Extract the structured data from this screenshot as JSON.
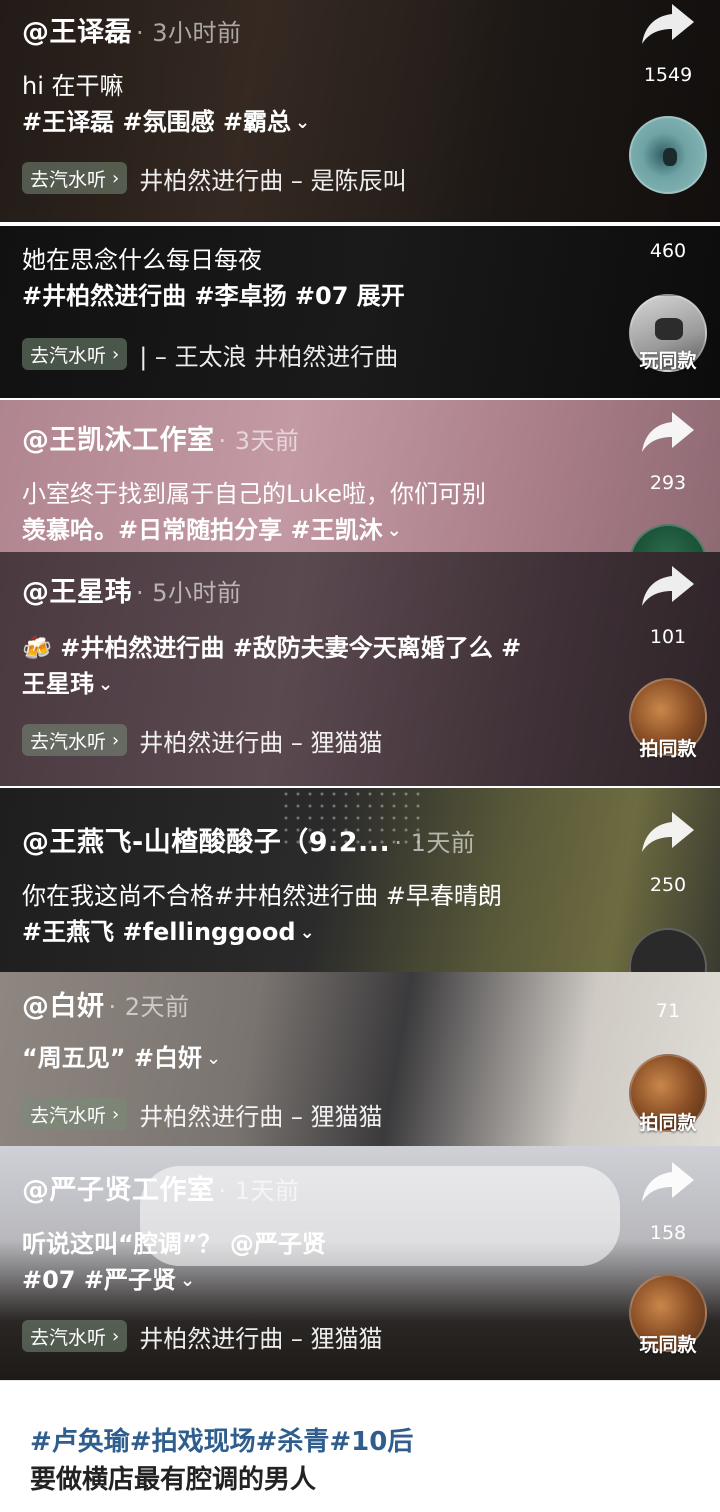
{
  "cards": [
    {
      "author": "@王译磊",
      "time": "· 3小时前",
      "desc_text": "hi 在干嘛",
      "desc_tags": "#王译磊 #氛围感 #霸总",
      "music_btn": "去汽水听",
      "music_text": "井柏然进行曲 – 是陈辰叫",
      "share_count": "1549",
      "disc_label": ""
    },
    {
      "author": "",
      "time": "",
      "desc_text": "她在思念什么每日每夜",
      "desc_tags": "#井柏然进行曲 #李卓扬 #07  展开",
      "music_btn": "去汽水听",
      "music_text": "| – 王太浪  井柏然进行曲",
      "share_count": "460",
      "disc_label": "玩同款"
    },
    {
      "author": "@王凯沐工作室",
      "time": "· 3天前",
      "desc_text": "小室终于找到属于自己的Luke啦，你们可别",
      "desc_tags": "羡慕哈。#日常随拍分享 #王凯沐",
      "share_count": "293",
      "disc_label": ""
    },
    {
      "author": "@王星玮",
      "time": "· 5小时前",
      "desc_text": "🍻 #井柏然进行曲 #敌防夫妻今天离婚了么 #",
      "desc_tags": "王星玮",
      "music_btn": "去汽水听",
      "music_text": "井柏然进行曲 – 狸猫猫",
      "share_count": "101",
      "disc_label": "拍同款"
    },
    {
      "author": "@王燕飞-山楂酸酸子（9.2...",
      "time": "· 1天前",
      "desc_text": "你在我这尚不合格#井柏然进行曲 #早春晴朗",
      "desc_tags": "#王燕飞 #fellinggood",
      "share_count": "250",
      "disc_label": ""
    },
    {
      "author": "@白妍",
      "time": "· 2天前",
      "desc_text": "“周五见” #白妍",
      "desc_tags": "",
      "music_btn": "去汽水听",
      "music_text": "井柏然进行曲 – 狸猫猫",
      "share_count": "71",
      "disc_label": "拍同款"
    },
    {
      "author": "@严子贤工作室",
      "time": "· 1天前",
      "desc_text": "听说这叫“腔调”？ @严子贤",
      "desc_tags": "#07  #严子贤",
      "music_btn": "去汽水听",
      "music_text": "井柏然进行曲 – 狸猫猫",
      "share_count": "158",
      "disc_label": "玩同款"
    }
  ],
  "footer": {
    "tags": "#卢奂瑜#拍戏现场#杀青#10后",
    "title": "要做横店最有腔调的男人"
  },
  "icons": {
    "share": "share-arrow-icon",
    "chevron": "chevron-down-icon",
    "music_arrow": "chevron-right-icon"
  }
}
